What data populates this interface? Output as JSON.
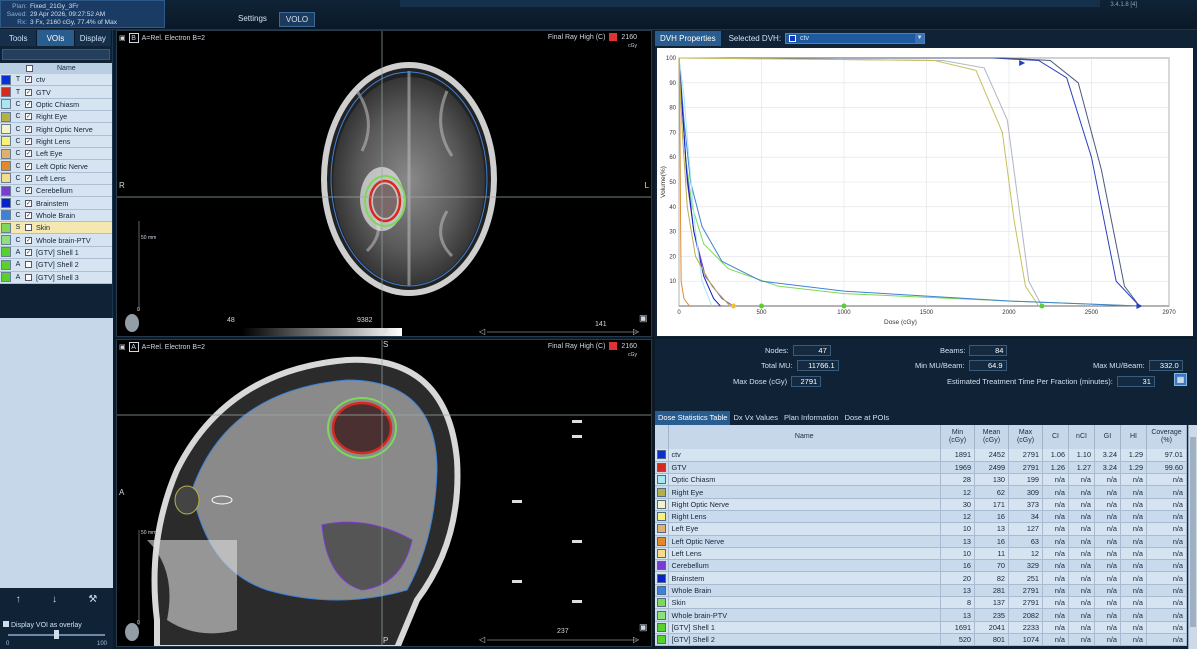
{
  "plan_info": {
    "plan_key": "Plan:",
    "plan": "Fixed_21Gy_3Fr",
    "saved_key": "Saved:",
    "saved": "29 Apr 2026, 09:27:52 AM",
    "rx_key": "Rx:",
    "rx": "3 Fx, 2160 cGy, 77.4% of Max"
  },
  "top_tabs": [
    "Settings",
    "VOLO"
  ],
  "version": "3.4.1.8 [4]",
  "left_tabs": [
    "Tools",
    "VOIs",
    "Display"
  ],
  "voi_header": "Name",
  "vois": [
    {
      "type": "T",
      "name": "ctv",
      "color": "#0b2fd6",
      "checked": true
    },
    {
      "type": "T",
      "name": "GTV",
      "color": "#d62a1e",
      "checked": true
    },
    {
      "type": "C",
      "name": "Optic Chiasm",
      "color": "#a8e6f0",
      "checked": true
    },
    {
      "type": "C",
      "name": "Right Eye",
      "color": "#b5b04a",
      "checked": true
    },
    {
      "type": "C",
      "name": "Right Optic Nerve",
      "color": "#f5f2c8",
      "checked": true
    },
    {
      "type": "C",
      "name": "Right Lens",
      "color": "#f7f27a",
      "checked": true
    },
    {
      "type": "C",
      "name": "Left Eye",
      "color": "#e0b070",
      "checked": true
    },
    {
      "type": "C",
      "name": "Left Optic Nerve",
      "color": "#e08a2c",
      "checked": true
    },
    {
      "type": "C",
      "name": "Left Lens",
      "color": "#f3dd8c",
      "checked": true
    },
    {
      "type": "C",
      "name": "Cerebellum",
      "color": "#7b3ad0",
      "checked": true
    },
    {
      "type": "C",
      "name": "Brainstem",
      "color": "#0a22c8",
      "checked": true
    },
    {
      "type": "C",
      "name": "Whole Brain",
      "color": "#3e82d8",
      "checked": true
    },
    {
      "type": "S",
      "name": "Skin",
      "color": "#7ed85a",
      "checked": false
    },
    {
      "type": "C",
      "name": "Whole brain-PTV",
      "color": "#8fe07a",
      "checked": true
    },
    {
      "type": "A",
      "name": "[GTV] Shell 1",
      "color": "#58d030",
      "checked": true
    },
    {
      "type": "A",
      "name": "[GTV] Shell 2",
      "color": "#58d030",
      "checked": false
    },
    {
      "type": "A",
      "name": "[GTV] Shell 3",
      "color": "#58d030",
      "checked": false
    }
  ],
  "overlay_label": "Display VOI as overlay",
  "slider": {
    "min": "0",
    "max": "100",
    "value": 50
  },
  "pane1": {
    "tag": "B",
    "tag_text": "A=Rel. Electron B=2",
    "render": "Final Ray High",
    "render_code": "(C)",
    "max_dose": "2160",
    "unit": "cGy",
    "left": "R",
    "right": "L",
    "bottom": "P",
    "scale": "50 mm",
    "zero": "0",
    "window_min": "48",
    "window_max": "9382",
    "slice": "141"
  },
  "pane2": {
    "tag": "A",
    "tag_text": "A=Rel. Electron B=2",
    "render": "Final Ray High",
    "render_code": "(C)",
    "max_dose": "2160",
    "unit": "cGy",
    "left": "A",
    "top": "S",
    "bottom": "P",
    "scale": "50 mm",
    "zero": "0",
    "slice": "237"
  },
  "dvh": {
    "tab": "DVH Properties",
    "selected_label": "Selected DVH:",
    "selected": "ctv"
  },
  "chart_data": {
    "type": "line",
    "title": "",
    "xlabel": "Dose (cGy)",
    "ylabel": "Volume(%)",
    "xlim": [
      0,
      2970
    ],
    "ylim": [
      0,
      100
    ],
    "x_ticks": [
      0,
      500,
      1000,
      1500,
      2000,
      2500,
      2970
    ],
    "y_ticks": [
      10,
      20,
      30,
      40,
      50,
      60,
      70,
      80,
      90,
      100
    ],
    "grid": true,
    "series": [
      {
        "color": "#2a3fbf",
        "x": [
          0,
          1900,
          2180,
          2350,
          2500,
          2650,
          2791
        ],
        "y": [
          100,
          100,
          99,
          92,
          60,
          10,
          0
        ]
      },
      {
        "color": "#4a5a7c",
        "x": [
          0,
          1969,
          2250,
          2420,
          2560,
          2700,
          2791
        ],
        "y": [
          100,
          100,
          99,
          90,
          55,
          8,
          0
        ]
      },
      {
        "color": "#b0b6c2",
        "x": [
          0,
          1600,
          1850,
          1990,
          2060,
          2120,
          2200
        ],
        "y": [
          100,
          99,
          96,
          75,
          40,
          10,
          0
        ]
      },
      {
        "color": "#c7bf5a",
        "x": [
          0,
          1550,
          1800,
          1960,
          2030,
          2100,
          2180
        ],
        "y": [
          100,
          99,
          95,
          70,
          35,
          8,
          0
        ]
      },
      {
        "color": "#7ed85a",
        "x": [
          0,
          40,
          80,
          150,
          300,
          600,
          1000,
          2000,
          2791
        ],
        "y": [
          100,
          60,
          40,
          25,
          15,
          8,
          5,
          2,
          0
        ]
      },
      {
        "color": "#3e82d8",
        "x": [
          0,
          30,
          70,
          140,
          260,
          500,
          1000,
          2000,
          2791
        ],
        "y": [
          100,
          75,
          50,
          32,
          18,
          10,
          6,
          2,
          0
        ]
      },
      {
        "color": "#7b3ad0",
        "x": [
          0,
          20,
          50,
          90,
          160,
          260,
          329
        ],
        "y": [
          100,
          80,
          50,
          30,
          12,
          3,
          0
        ]
      },
      {
        "color": "#0a22c8",
        "x": [
          0,
          20,
          45,
          90,
          150,
          210,
          251
        ],
        "y": [
          100,
          80,
          55,
          30,
          12,
          3,
          0
        ]
      },
      {
        "color": "#a8e6f0",
        "x": [
          0,
          30,
          60,
          100,
          140,
          199
        ],
        "y": [
          100,
          85,
          60,
          30,
          10,
          0
        ]
      },
      {
        "color": "#e08a2c",
        "x": [
          0,
          5,
          10,
          13,
          30,
          63
        ],
        "y": [
          100,
          80,
          30,
          10,
          3,
          0
        ]
      },
      {
        "color": "#b5b04a",
        "x": [
          0,
          20,
          50,
          100,
          200,
          309
        ],
        "y": [
          100,
          70,
          40,
          20,
          8,
          0
        ]
      }
    ],
    "markers": [
      {
        "x": 2080,
        "y": 98,
        "color": "#2040c0",
        "shape": "triangle"
      },
      {
        "x": 2791,
        "y": 0,
        "color": "#2040c0",
        "shape": "triangle"
      },
      {
        "x": 330,
        "y": 0,
        "color": "#f0c030",
        "shape": "circle"
      },
      {
        "x": 500,
        "y": 0,
        "color": "#58d030",
        "shape": "circle"
      },
      {
        "x": 1000,
        "y": 0,
        "color": "#58d030",
        "shape": "circle"
      },
      {
        "x": 2200,
        "y": 0,
        "color": "#58d030",
        "shape": "circle"
      }
    ]
  },
  "plan_stats": {
    "nodes_label": "Nodes:",
    "nodes": "47",
    "beams_label": "Beams:",
    "beams": "84",
    "total_mu_label": "Total MU:",
    "total_mu": "11766.1",
    "min_mu_label": "Min MU/Beam:",
    "min_mu": "64.9",
    "max_mu_label": "Max MU/Beam:",
    "max_mu": "332.0",
    "max_dose_label": "Max Dose (cGy)",
    "max_dose": "2791",
    "time_label": "Estimated Treatment Time Per Fraction (minutes):",
    "time": "31"
  },
  "table_tabs": [
    "Dose Statistics Table",
    "Dx Vx Values",
    "Plan Information",
    "Dose at POIs"
  ],
  "table_headers": [
    "Name",
    "Min\n(cGy)",
    "Mean\n(cGy)",
    "Max\n(cGy)",
    "CI",
    "nCI",
    "GI",
    "HI",
    "Coverage\n(%)"
  ],
  "table_rows": [
    {
      "name": "ctv",
      "color": "#0b2fd6",
      "v": [
        "1891",
        "2452",
        "2791",
        "1.06",
        "1.10",
        "3.24",
        "1.29",
        "97.01"
      ]
    },
    {
      "name": "GTV",
      "color": "#d62a1e",
      "v": [
        "1969",
        "2499",
        "2791",
        "1.26",
        "1.27",
        "3.24",
        "1.29",
        "99.60"
      ]
    },
    {
      "name": "Optic Chiasm",
      "color": "#a8e6f0",
      "v": [
        "28",
        "130",
        "199",
        "n/a",
        "n/a",
        "n/a",
        "n/a",
        "n/a"
      ]
    },
    {
      "name": "Right Eye",
      "color": "#b5b04a",
      "v": [
        "12",
        "62",
        "309",
        "n/a",
        "n/a",
        "n/a",
        "n/a",
        "n/a"
      ]
    },
    {
      "name": "Right Optic Nerve",
      "color": "#f5f2c8",
      "v": [
        "30",
        "171",
        "373",
        "n/a",
        "n/a",
        "n/a",
        "n/a",
        "n/a"
      ]
    },
    {
      "name": "Right Lens",
      "color": "#f7f27a",
      "v": [
        "12",
        "16",
        "34",
        "n/a",
        "n/a",
        "n/a",
        "n/a",
        "n/a"
      ]
    },
    {
      "name": "Left Eye",
      "color": "#e0b070",
      "v": [
        "10",
        "13",
        "127",
        "n/a",
        "n/a",
        "n/a",
        "n/a",
        "n/a"
      ]
    },
    {
      "name": "Left Optic Nerve",
      "color": "#e08a2c",
      "v": [
        "13",
        "16",
        "63",
        "n/a",
        "n/a",
        "n/a",
        "n/a",
        "n/a"
      ]
    },
    {
      "name": "Left Lens",
      "color": "#f3dd8c",
      "v": [
        "10",
        "11",
        "12",
        "n/a",
        "n/a",
        "n/a",
        "n/a",
        "n/a"
      ]
    },
    {
      "name": "Cerebellum",
      "color": "#7b3ad0",
      "v": [
        "16",
        "70",
        "329",
        "n/a",
        "n/a",
        "n/a",
        "n/a",
        "n/a"
      ]
    },
    {
      "name": "Brainstem",
      "color": "#0a22c8",
      "v": [
        "20",
        "82",
        "251",
        "n/a",
        "n/a",
        "n/a",
        "n/a",
        "n/a"
      ]
    },
    {
      "name": "Whole Brain",
      "color": "#3e82d8",
      "v": [
        "13",
        "281",
        "2791",
        "n/a",
        "n/a",
        "n/a",
        "n/a",
        "n/a"
      ]
    },
    {
      "name": "Skin",
      "color": "#7ed85a",
      "v": [
        "8",
        "137",
        "2791",
        "n/a",
        "n/a",
        "n/a",
        "n/a",
        "n/a"
      ]
    },
    {
      "name": "Whole brain-PTV",
      "color": "#8fe07a",
      "v": [
        "13",
        "235",
        "2082",
        "n/a",
        "n/a",
        "n/a",
        "n/a",
        "n/a"
      ]
    },
    {
      "name": "[GTV] Shell 1",
      "color": "#58d030",
      "v": [
        "1691",
        "2041",
        "2233",
        "n/a",
        "n/a",
        "n/a",
        "n/a",
        "n/a"
      ]
    },
    {
      "name": "[GTV] Shell 2",
      "color": "#58d030",
      "v": [
        "520",
        "801",
        "1074",
        "n/a",
        "n/a",
        "n/a",
        "n/a",
        "n/a"
      ]
    }
  ]
}
